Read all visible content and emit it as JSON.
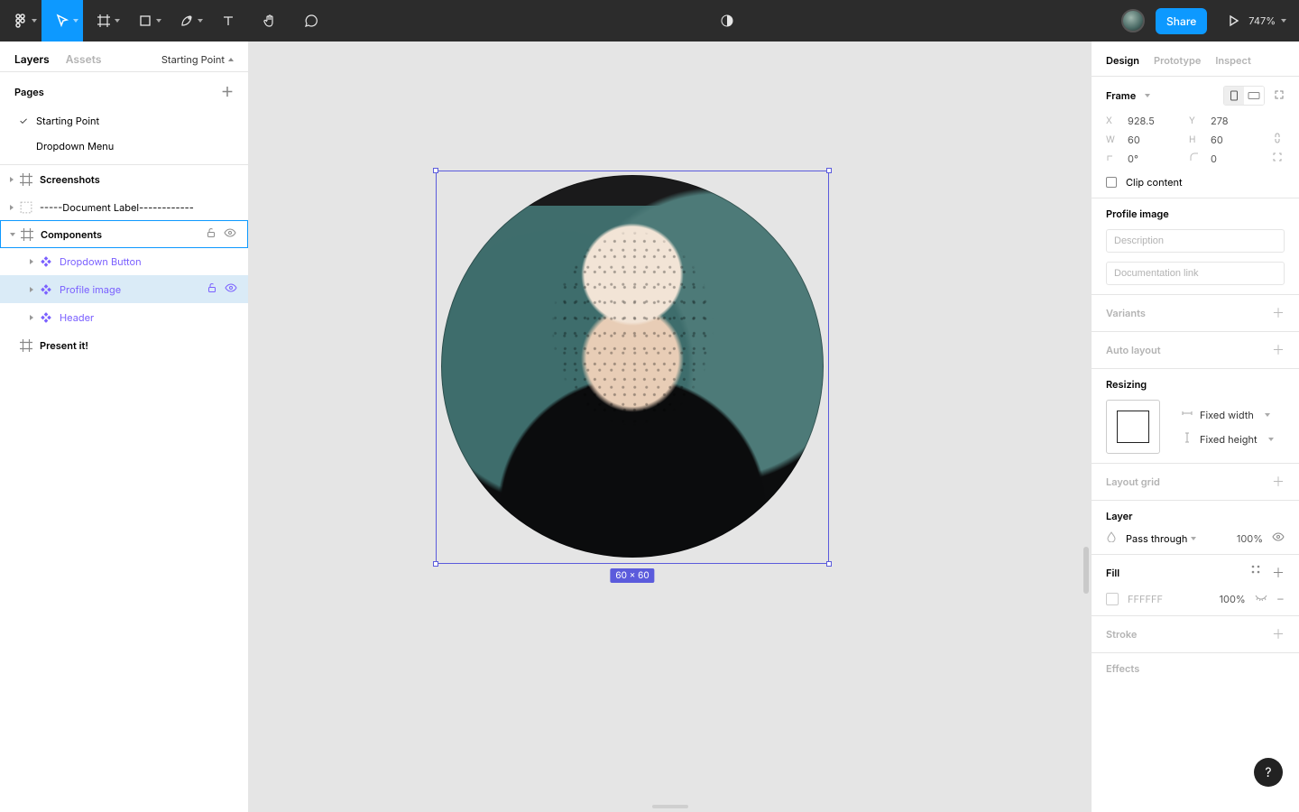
{
  "topbar": {
    "share_label": "Share",
    "zoom": "747%"
  },
  "left": {
    "tabs": {
      "layers": "Layers",
      "assets": "Assets"
    },
    "starting_point": "Starting Point",
    "pages_title": "Pages",
    "pages": [
      {
        "label": "Starting Point",
        "current": true
      },
      {
        "label": "Dropdown Menu",
        "current": false
      }
    ],
    "layers": [
      {
        "id": "screenshots",
        "label": "Screenshots",
        "kind": "frame",
        "indent": 0
      },
      {
        "id": "doclabel",
        "label": "-----Document Label------------",
        "kind": "group",
        "indent": 0
      },
      {
        "id": "components",
        "label": "Components",
        "kind": "frame",
        "indent": 0,
        "outlined": true,
        "actions": true,
        "actions_color": "default"
      },
      {
        "id": "dropdownbtn",
        "label": "Dropdown Button",
        "kind": "component",
        "indent": 1,
        "purple": true
      },
      {
        "id": "profileimg",
        "label": "Profile image",
        "kind": "component",
        "indent": 1,
        "purple": true,
        "selected": true,
        "actions": true,
        "actions_color": "purple"
      },
      {
        "id": "header",
        "label": "Header",
        "kind": "component",
        "indent": 1,
        "purple": true
      },
      {
        "id": "present",
        "label": "Present it!",
        "kind": "frame",
        "indent": 0
      }
    ]
  },
  "canvas": {
    "dim_badge": "60 × 60"
  },
  "right": {
    "tabs": {
      "design": "Design",
      "prototype": "Prototype",
      "inspect": "Inspect"
    },
    "frame": {
      "label": "Frame",
      "x_label": "X",
      "x": "928.5",
      "y_label": "Y",
      "y": "278",
      "w_label": "W",
      "w": "60",
      "h_label": "H",
      "h": "60",
      "rot_label": "",
      "rot": "0°",
      "corner_label": "",
      "corner": "0",
      "clip_label": "Clip content"
    },
    "component": {
      "title": "Profile image",
      "desc_placeholder": "Description",
      "doc_placeholder": "Documentation link"
    },
    "variants_title": "Variants",
    "autolayout_title": "Auto layout",
    "resizing": {
      "title": "Resizing",
      "width": "Fixed width",
      "height": "Fixed height"
    },
    "layoutgrid_title": "Layout grid",
    "layer": {
      "title": "Layer",
      "blend": "Pass through",
      "opacity": "100%"
    },
    "fill": {
      "title": "Fill",
      "hex": "FFFFFF",
      "opacity": "100%"
    },
    "stroke_title": "Stroke",
    "effects_title": "Effects"
  }
}
